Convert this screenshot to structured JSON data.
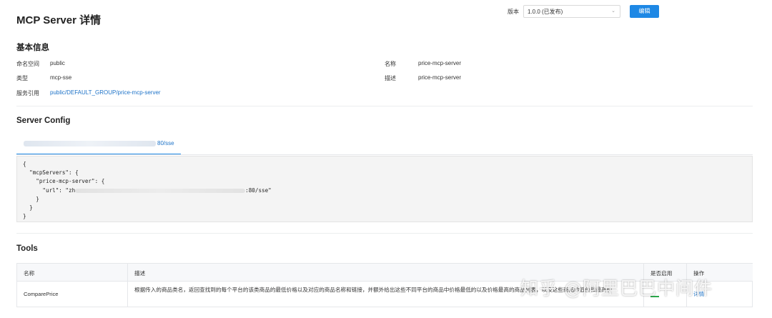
{
  "header": {
    "title": "MCP Server 详情",
    "version_label": "版本",
    "version_value": "1.0.0 (已发布)",
    "edit_label": "编辑"
  },
  "basic_info": {
    "section_title": "基本信息",
    "namespace_label": "命名空间",
    "namespace_value": "public",
    "name_label": "名称",
    "name_value": "price-mcp-server",
    "type_label": "类型",
    "type_value": "mcp-sse",
    "desc_label": "描述",
    "desc_value": "price-mcp-server",
    "service_ref_label": "服务引用",
    "service_ref_value": "public/DEFAULT_GROUP/price-mcp-server"
  },
  "server_config": {
    "section_title": "Server Config",
    "tab_suffix": "80/sse",
    "code": {
      "l1": "{",
      "l2": "  \"mcpServers\": {",
      "l3": "    \"price-mcp-server\": {",
      "l4_prefix": "      \"url\": \"zh",
      "l4_suffix": ":80/sse\"",
      "l5": "    }",
      "l6": "  }",
      "l7": "}"
    }
  },
  "tools": {
    "section_title": "Tools",
    "columns": {
      "name": "名称",
      "desc": "描述",
      "enabled": "是否启用",
      "actions": "操作"
    },
    "rows": [
      {
        "name": "ComparePrice",
        "desc": "根据传入的商品类名，返回查找到的每个平台的该类商品的最低价格以及对应的商品名称和链接，并额外给出这些不同平台的商品中价格最低的以及价格最高的商品列表，以及这些商品的低价和最高价",
        "action": "详情"
      }
    ]
  },
  "watermark": "知乎 @阿里巴巴中间件"
}
